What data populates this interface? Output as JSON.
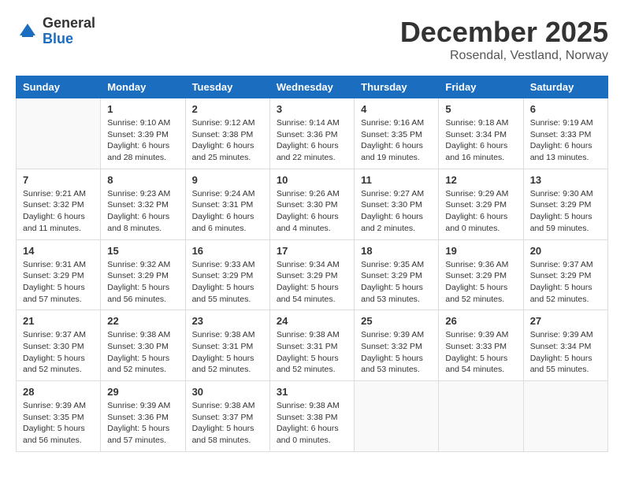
{
  "header": {
    "logo_general": "General",
    "logo_blue": "Blue",
    "month_title": "December 2025",
    "subtitle": "Rosendal, Vestland, Norway"
  },
  "days_of_week": [
    "Sunday",
    "Monday",
    "Tuesday",
    "Wednesday",
    "Thursday",
    "Friday",
    "Saturday"
  ],
  "weeks": [
    [
      {
        "day": "",
        "info": ""
      },
      {
        "day": "1",
        "info": "Sunrise: 9:10 AM\nSunset: 3:39 PM\nDaylight: 6 hours\nand 28 minutes."
      },
      {
        "day": "2",
        "info": "Sunrise: 9:12 AM\nSunset: 3:38 PM\nDaylight: 6 hours\nand 25 minutes."
      },
      {
        "day": "3",
        "info": "Sunrise: 9:14 AM\nSunset: 3:36 PM\nDaylight: 6 hours\nand 22 minutes."
      },
      {
        "day": "4",
        "info": "Sunrise: 9:16 AM\nSunset: 3:35 PM\nDaylight: 6 hours\nand 19 minutes."
      },
      {
        "day": "5",
        "info": "Sunrise: 9:18 AM\nSunset: 3:34 PM\nDaylight: 6 hours\nand 16 minutes."
      },
      {
        "day": "6",
        "info": "Sunrise: 9:19 AM\nSunset: 3:33 PM\nDaylight: 6 hours\nand 13 minutes."
      }
    ],
    [
      {
        "day": "7",
        "info": "Sunrise: 9:21 AM\nSunset: 3:32 PM\nDaylight: 6 hours\nand 11 minutes."
      },
      {
        "day": "8",
        "info": "Sunrise: 9:23 AM\nSunset: 3:32 PM\nDaylight: 6 hours\nand 8 minutes."
      },
      {
        "day": "9",
        "info": "Sunrise: 9:24 AM\nSunset: 3:31 PM\nDaylight: 6 hours\nand 6 minutes."
      },
      {
        "day": "10",
        "info": "Sunrise: 9:26 AM\nSunset: 3:30 PM\nDaylight: 6 hours\nand 4 minutes."
      },
      {
        "day": "11",
        "info": "Sunrise: 9:27 AM\nSunset: 3:30 PM\nDaylight: 6 hours\nand 2 minutes."
      },
      {
        "day": "12",
        "info": "Sunrise: 9:29 AM\nSunset: 3:29 PM\nDaylight: 6 hours\nand 0 minutes."
      },
      {
        "day": "13",
        "info": "Sunrise: 9:30 AM\nSunset: 3:29 PM\nDaylight: 5 hours\nand 59 minutes."
      }
    ],
    [
      {
        "day": "14",
        "info": "Sunrise: 9:31 AM\nSunset: 3:29 PM\nDaylight: 5 hours\nand 57 minutes."
      },
      {
        "day": "15",
        "info": "Sunrise: 9:32 AM\nSunset: 3:29 PM\nDaylight: 5 hours\nand 56 minutes."
      },
      {
        "day": "16",
        "info": "Sunrise: 9:33 AM\nSunset: 3:29 PM\nDaylight: 5 hours\nand 55 minutes."
      },
      {
        "day": "17",
        "info": "Sunrise: 9:34 AM\nSunset: 3:29 PM\nDaylight: 5 hours\nand 54 minutes."
      },
      {
        "day": "18",
        "info": "Sunrise: 9:35 AM\nSunset: 3:29 PM\nDaylight: 5 hours\nand 53 minutes."
      },
      {
        "day": "19",
        "info": "Sunrise: 9:36 AM\nSunset: 3:29 PM\nDaylight: 5 hours\nand 52 minutes."
      },
      {
        "day": "20",
        "info": "Sunrise: 9:37 AM\nSunset: 3:29 PM\nDaylight: 5 hours\nand 52 minutes."
      }
    ],
    [
      {
        "day": "21",
        "info": "Sunrise: 9:37 AM\nSunset: 3:30 PM\nDaylight: 5 hours\nand 52 minutes."
      },
      {
        "day": "22",
        "info": "Sunrise: 9:38 AM\nSunset: 3:30 PM\nDaylight: 5 hours\nand 52 minutes."
      },
      {
        "day": "23",
        "info": "Sunrise: 9:38 AM\nSunset: 3:31 PM\nDaylight: 5 hours\nand 52 minutes."
      },
      {
        "day": "24",
        "info": "Sunrise: 9:38 AM\nSunset: 3:31 PM\nDaylight: 5 hours\nand 52 minutes."
      },
      {
        "day": "25",
        "info": "Sunrise: 9:39 AM\nSunset: 3:32 PM\nDaylight: 5 hours\nand 53 minutes."
      },
      {
        "day": "26",
        "info": "Sunrise: 9:39 AM\nSunset: 3:33 PM\nDaylight: 5 hours\nand 54 minutes."
      },
      {
        "day": "27",
        "info": "Sunrise: 9:39 AM\nSunset: 3:34 PM\nDaylight: 5 hours\nand 55 minutes."
      }
    ],
    [
      {
        "day": "28",
        "info": "Sunrise: 9:39 AM\nSunset: 3:35 PM\nDaylight: 5 hours\nand 56 minutes."
      },
      {
        "day": "29",
        "info": "Sunrise: 9:39 AM\nSunset: 3:36 PM\nDaylight: 5 hours\nand 57 minutes."
      },
      {
        "day": "30",
        "info": "Sunrise: 9:38 AM\nSunset: 3:37 PM\nDaylight: 5 hours\nand 58 minutes."
      },
      {
        "day": "31",
        "info": "Sunrise: 9:38 AM\nSunset: 3:38 PM\nDaylight: 6 hours\nand 0 minutes."
      },
      {
        "day": "",
        "info": ""
      },
      {
        "day": "",
        "info": ""
      },
      {
        "day": "",
        "info": ""
      }
    ]
  ]
}
